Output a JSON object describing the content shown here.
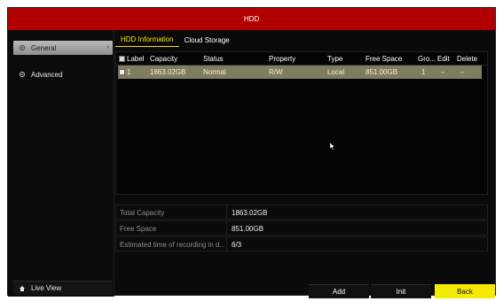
{
  "window": {
    "title": "HDD"
  },
  "sidebar": {
    "items": [
      {
        "label": "General",
        "active": true,
        "icon": "gear-icon"
      },
      {
        "label": "Advanced",
        "active": false,
        "icon": "gear-icon"
      }
    ],
    "live_view": "Live View"
  },
  "tabs": [
    {
      "label": "HDD Information",
      "active": true
    },
    {
      "label": "Cloud Storage",
      "active": false
    }
  ],
  "table": {
    "headers": [
      "Label",
      "Capacity",
      "Status",
      "Property",
      "Type",
      "Free Space",
      "Gro...",
      "Edit",
      "Delete"
    ],
    "rows": [
      {
        "label": "1",
        "capacity": "1863.02GB",
        "status": "Normal",
        "property": "R/W",
        "type": "Local",
        "free": "851.00GB",
        "group": "1",
        "edit": "–",
        "delete": "–"
      }
    ]
  },
  "info": [
    {
      "label": "Total Capacity",
      "value": "1863.02GB"
    },
    {
      "label": "Free Space",
      "value": "851.00GB"
    },
    {
      "label": "Estimated time of recording in d...",
      "value": "6/3"
    }
  ],
  "buttons": {
    "add": "Add",
    "init": "Init",
    "back": "Back"
  },
  "colors": {
    "title_bar": "#b20000",
    "tab_active": "#f3e600",
    "back_button": "#f4ea00",
    "selected_row": "#7f7c61"
  }
}
